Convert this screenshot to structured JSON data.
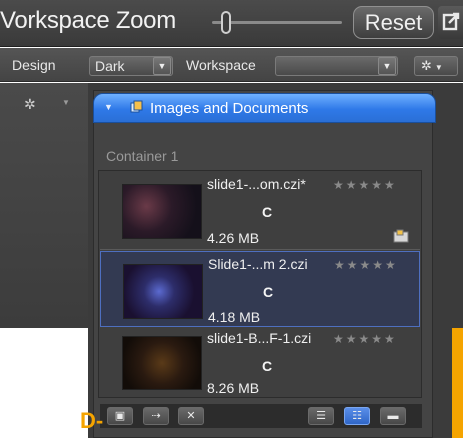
{
  "top_bar": {
    "title": "Vorkspace Zoom",
    "reset_label": "Reset"
  },
  "design_bar": {
    "design_label": "Design",
    "design_value": "Dark",
    "workspace_label": "Workspace",
    "workspace_value": ""
  },
  "panel": {
    "title": "Images and Documents",
    "container_label": "Container 1",
    "items": [
      {
        "name": "slide1-...om.czi*",
        "tag": "C",
        "size": "4.26 MB",
        "rating": "★★★★★",
        "selected": false
      },
      {
        "name": "Slide1-...m 2.czi",
        "tag": "C",
        "size": "4.18 MB",
        "rating": "★★★★★",
        "selected": true
      },
      {
        "name": "slide1-B...F-1.czi",
        "tag": "C",
        "size": "8.26 MB",
        "rating": "★★★★★",
        "selected": false
      }
    ]
  },
  "annotation": {
    "label": "D-"
  },
  "colors": {
    "accent": "#2f79e8",
    "annotation": "#f5a400",
    "background": "#3b3b3b"
  }
}
